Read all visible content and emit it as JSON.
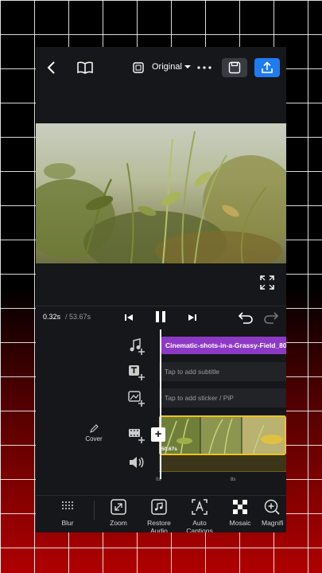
{
  "topbar": {
    "aspect_label": "Original"
  },
  "playback": {
    "current_time": "0.32s",
    "total_time": "/ 53.67s"
  },
  "tracks": {
    "music_clip_title": "Cinematic-shots-in-a-Grassy-Field_80...",
    "subtitle_placeholder": "Tap to add subtitle",
    "sticker_placeholder": "Tap to add sticker / PiP",
    "clip_duration": "50.67s",
    "cover_label": "Cover",
    "ruler": [
      "0s",
      "8s"
    ]
  },
  "toolbar": {
    "blur": "Blur",
    "zoom": "Zoom",
    "restore_audio": "Restore Audio",
    "auto_captions": "Auto Captions",
    "mosaic": "Mosaic",
    "magnifier": "Magnifi"
  },
  "colors": {
    "accent": "#1e7bf0",
    "music_clip": "#8e39c6",
    "clip_border": "#f0c419"
  }
}
